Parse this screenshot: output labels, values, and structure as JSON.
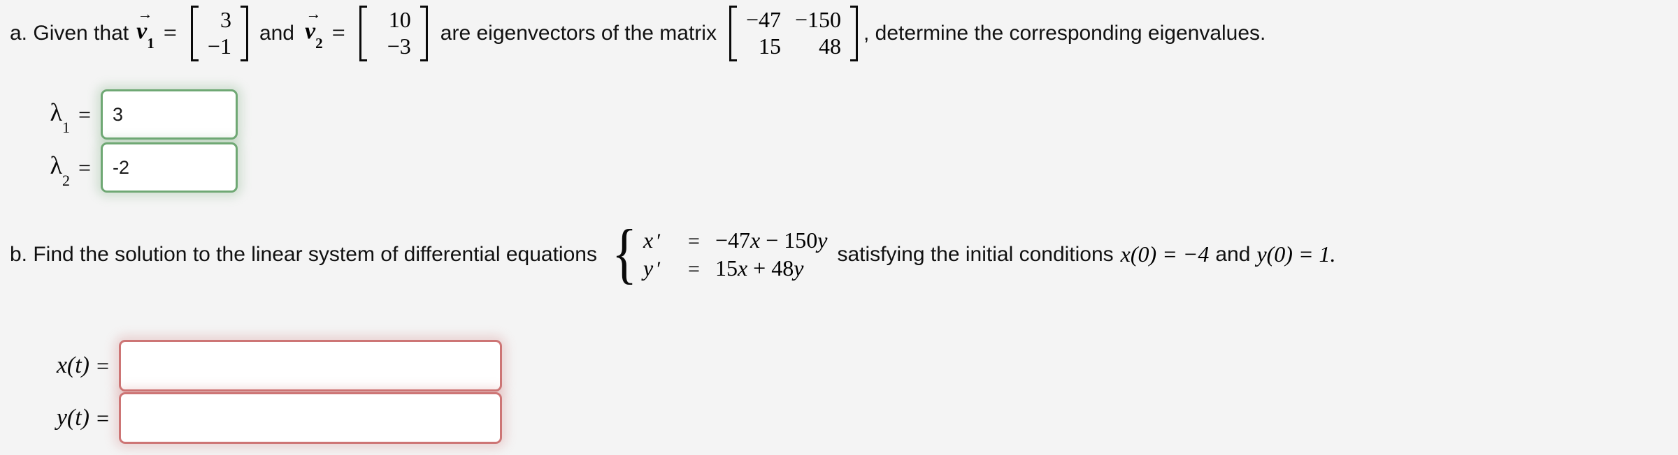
{
  "background_color": "#f4f4f4",
  "accent_colors": {
    "valid_border": "#6fa874",
    "invalid_border": "#cd7575",
    "text": "#111111"
  },
  "problem_a": {
    "label": "a. Given that",
    "vector1": {
      "symbol": "v",
      "subscript": "1",
      "entries": [
        "3",
        "−1"
      ]
    },
    "conjunction": "and",
    "vector2": {
      "symbol": "v",
      "subscript": "2",
      "entries": [
        "10",
        "−3"
      ]
    },
    "middle_text": "are eigenvectors of the matrix",
    "matrix": {
      "rows": [
        [
          "−47",
          "−150"
        ],
        [
          "15",
          "48"
        ]
      ]
    },
    "tail_text": ", determine the corresponding eigenvalues.",
    "answers": [
      {
        "label": "λ",
        "subscript": "1",
        "equals": "=",
        "value": "3",
        "placeholder": "",
        "state": "green"
      },
      {
        "label": "λ",
        "subscript": "2",
        "equals": "=",
        "value": "-2",
        "placeholder": "",
        "state": "green"
      }
    ]
  },
  "problem_b": {
    "label": "b. Find the solution to the linear system of differential equations",
    "system": {
      "rows": [
        {
          "lhs": "x",
          "prime": "′",
          "equals": "=",
          "rhs_parts": [
            "−47",
            "x",
            " − ",
            "150",
            "y"
          ],
          "rhs": "−47x − 150y"
        },
        {
          "lhs": "y",
          "prime": "′",
          "equals": "=",
          "rhs_parts": [
            "15",
            "x",
            " + ",
            "48",
            "y"
          ],
          "rhs": "15x + 48y"
        }
      ]
    },
    "tail_text": "satisfying the initial conditions",
    "initial_conditions": {
      "x_condition": "x(0) = −4",
      "conjunction": "and",
      "y_condition": "y(0) = 1."
    },
    "answers": [
      {
        "label": "x(t)",
        "equals": "=",
        "value": "",
        "placeholder": "",
        "state": "red"
      },
      {
        "label": "y(t)",
        "equals": "=",
        "value": "",
        "placeholder": "",
        "state": "red"
      }
    ]
  }
}
